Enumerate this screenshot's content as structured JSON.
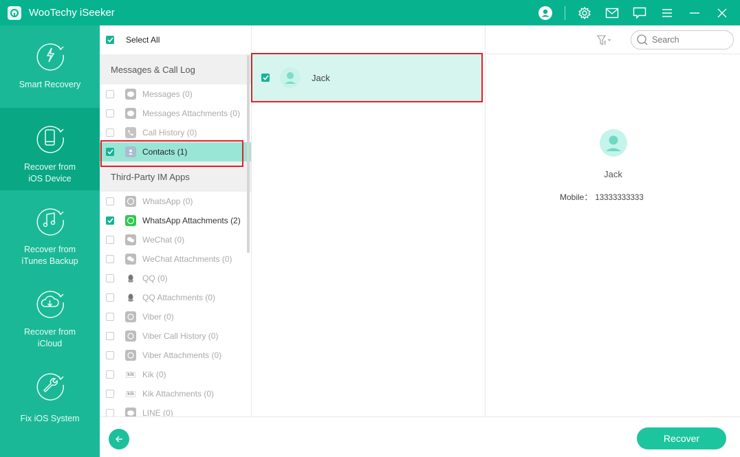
{
  "app": {
    "title": "WooTechy iSeeker"
  },
  "titlebar": {
    "icons": [
      "account-icon",
      "settings-icon",
      "mail-icon",
      "feedback-icon",
      "menu-icon",
      "minimize-icon",
      "close-icon"
    ]
  },
  "sidebar": {
    "items": [
      {
        "label": "Smart Recovery",
        "icon": "lightning-refresh-icon",
        "active": false
      },
      {
        "label": "Recover from\niOS Device",
        "line1": "Recover from",
        "line2": "iOS Device",
        "icon": "phone-refresh-icon",
        "active": true
      },
      {
        "label": "Recover from iTunes Backup",
        "line1": "Recover from",
        "line2": "iTunes Backup",
        "icon": "music-refresh-icon",
        "active": false
      },
      {
        "label": "Recover from iCloud",
        "line1": "Recover from",
        "line2": "iCloud",
        "icon": "cloud-download-refresh-icon",
        "active": false
      },
      {
        "label": "Fix iOS System",
        "icon": "wrench-refresh-icon",
        "active": false
      }
    ]
  },
  "categories": {
    "select_all_label": "Select All",
    "select_all_checked": true,
    "groups": [
      {
        "title": "Messages & Call Log",
        "items": [
          {
            "label": "Messages (0)",
            "icon": "message-bubble-icon",
            "checked": false
          },
          {
            "label": "Messages Attachments (0)",
            "icon": "message-bubble-icon",
            "checked": false
          },
          {
            "label": "Call History (0)",
            "icon": "phone-icon",
            "checked": false
          },
          {
            "label": "Contacts (1)",
            "icon": "contacts-icon",
            "checked": true,
            "selected": true
          }
        ]
      },
      {
        "title": "Third-Party IM Apps",
        "items": [
          {
            "label": "WhatsApp (0)",
            "icon": "whatsapp-icon",
            "checked": false
          },
          {
            "label": "WhatsApp Attachments (2)",
            "icon": "whatsapp-icon",
            "checked": true
          },
          {
            "label": "WeChat (0)",
            "icon": "wechat-icon",
            "checked": false
          },
          {
            "label": "WeChat Attachments (0)",
            "icon": "wechat-icon",
            "checked": false
          },
          {
            "label": "QQ (0)",
            "icon": "qq-icon",
            "checked": false
          },
          {
            "label": "QQ Attachments (0)",
            "icon": "qq-icon",
            "checked": false
          },
          {
            "label": "Viber (0)",
            "icon": "viber-icon",
            "checked": false
          },
          {
            "label": "Viber Call History (0)",
            "icon": "viber-icon",
            "checked": false
          },
          {
            "label": "Viber Attachments (0)",
            "icon": "viber-icon",
            "checked": false
          },
          {
            "label": "Kik (0)",
            "icon": "kik-icon",
            "checked": false
          },
          {
            "label": "Kik Attachments (0)",
            "icon": "kik-icon",
            "checked": false
          },
          {
            "label": "LINE (0)",
            "icon": "line-icon",
            "checked": false
          }
        ]
      }
    ]
  },
  "list": {
    "items": [
      {
        "name": "Jack",
        "checked": true,
        "selected": true
      }
    ]
  },
  "toolbar": {
    "filter_icon": "filter-icon",
    "search_placeholder": "Search"
  },
  "detail": {
    "name": "Jack",
    "mobile_label": "Mobile：",
    "mobile_value": "13333333333"
  },
  "footer": {
    "back_icon": "arrow-left-icon",
    "recover_label": "Recover"
  },
  "colors": {
    "brand": "#07b28f",
    "sidebar": "#1ab896",
    "sidebar_active": "#09a784",
    "highlight": "#9ae6d5",
    "list_selected": "#d6f5ef",
    "annotation_red": "#e0202a",
    "button": "#1dc59e"
  }
}
